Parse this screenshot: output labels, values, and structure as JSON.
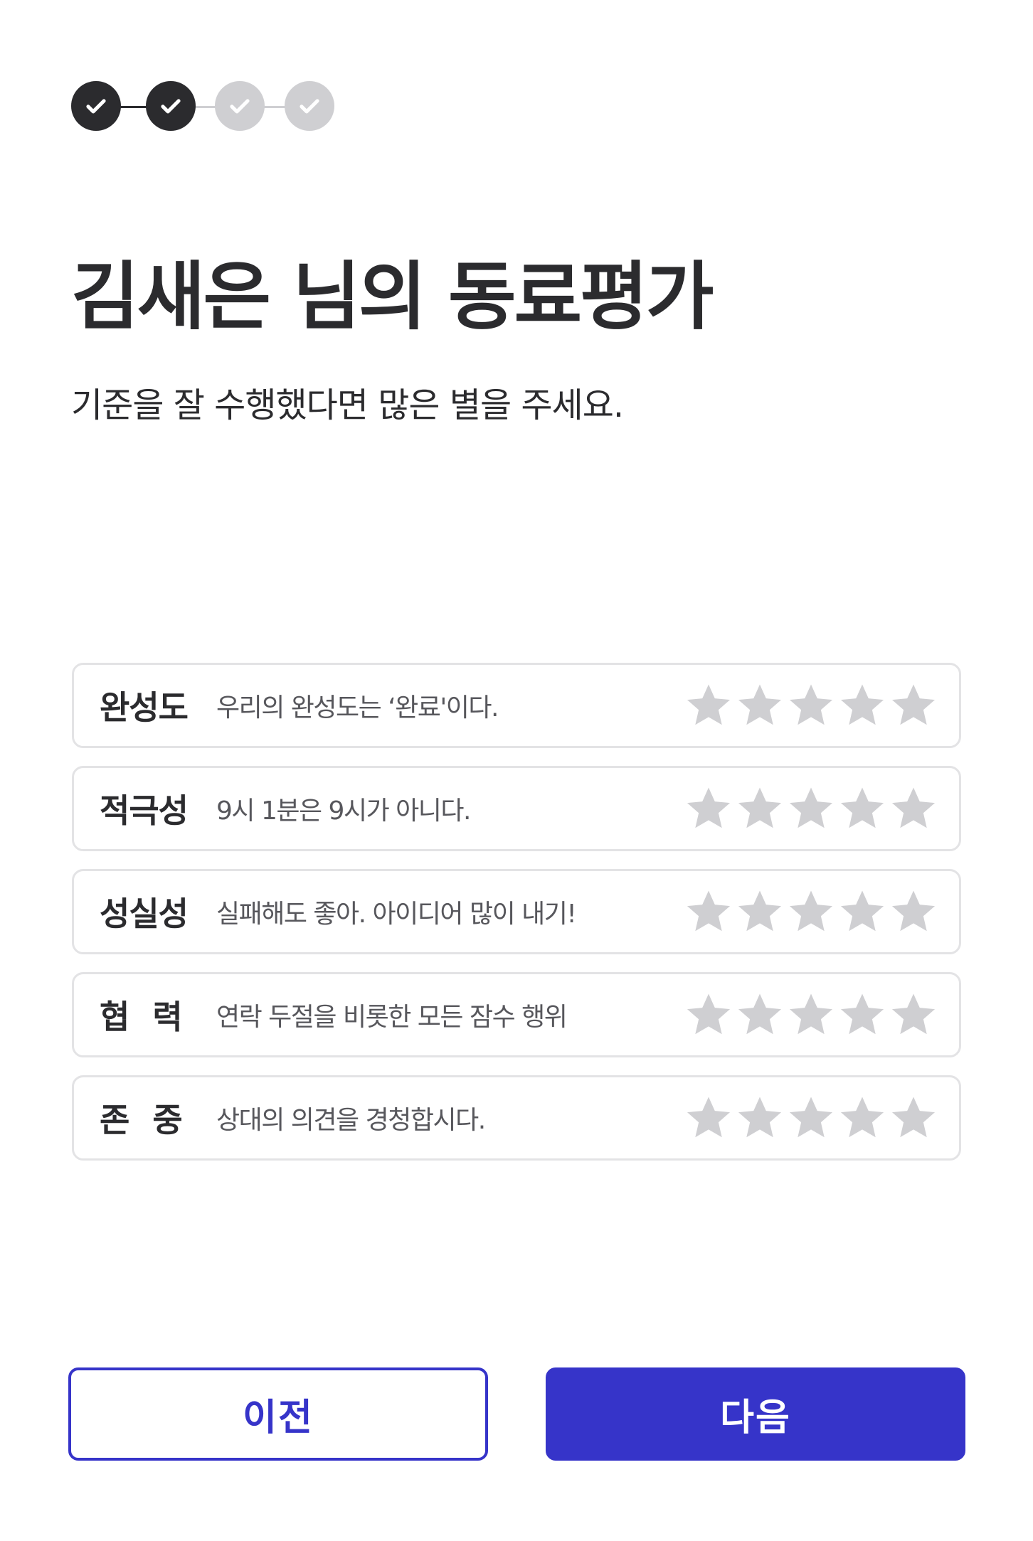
{
  "colors": {
    "step_done": "#2b2b2e",
    "step_pending": "#cfcfd2",
    "star_empty": "#cfcfd2",
    "accent": "#3634c9",
    "border": "#e3e3e5"
  },
  "stepper": {
    "steps": [
      {
        "state": "done",
        "icon": "check-icon"
      },
      {
        "state": "done",
        "icon": "check-icon"
      },
      {
        "state": "pending",
        "icon": "check-icon"
      },
      {
        "state": "pending",
        "icon": "check-icon"
      }
    ],
    "completed": 2,
    "total": 4
  },
  "header": {
    "title": "김새은 님의 동료평가",
    "subtitle": "기준을 잘 수행했다면 많은 별을 주세요."
  },
  "criteria": [
    {
      "name": "완성도",
      "description": "우리의 완성도는 ‘완료'이다.",
      "rating": 0,
      "max_rating": 5
    },
    {
      "name": "적극성",
      "description": "9시 1분은 9시가 아니다.",
      "rating": 0,
      "max_rating": 5
    },
    {
      "name": "성실성",
      "description": "실패해도 좋아. 아이디어 많이 내기!",
      "rating": 0,
      "max_rating": 5
    },
    {
      "name": "협력",
      "description": "연락 두절을 비롯한 모든 잠수 행위",
      "rating": 0,
      "max_rating": 5
    },
    {
      "name": "존중",
      "description": "상대의 의견을 경청합시다.",
      "rating": 0,
      "max_rating": 5
    }
  ],
  "buttons": {
    "prev_label": "이전",
    "next_label": "다음"
  }
}
